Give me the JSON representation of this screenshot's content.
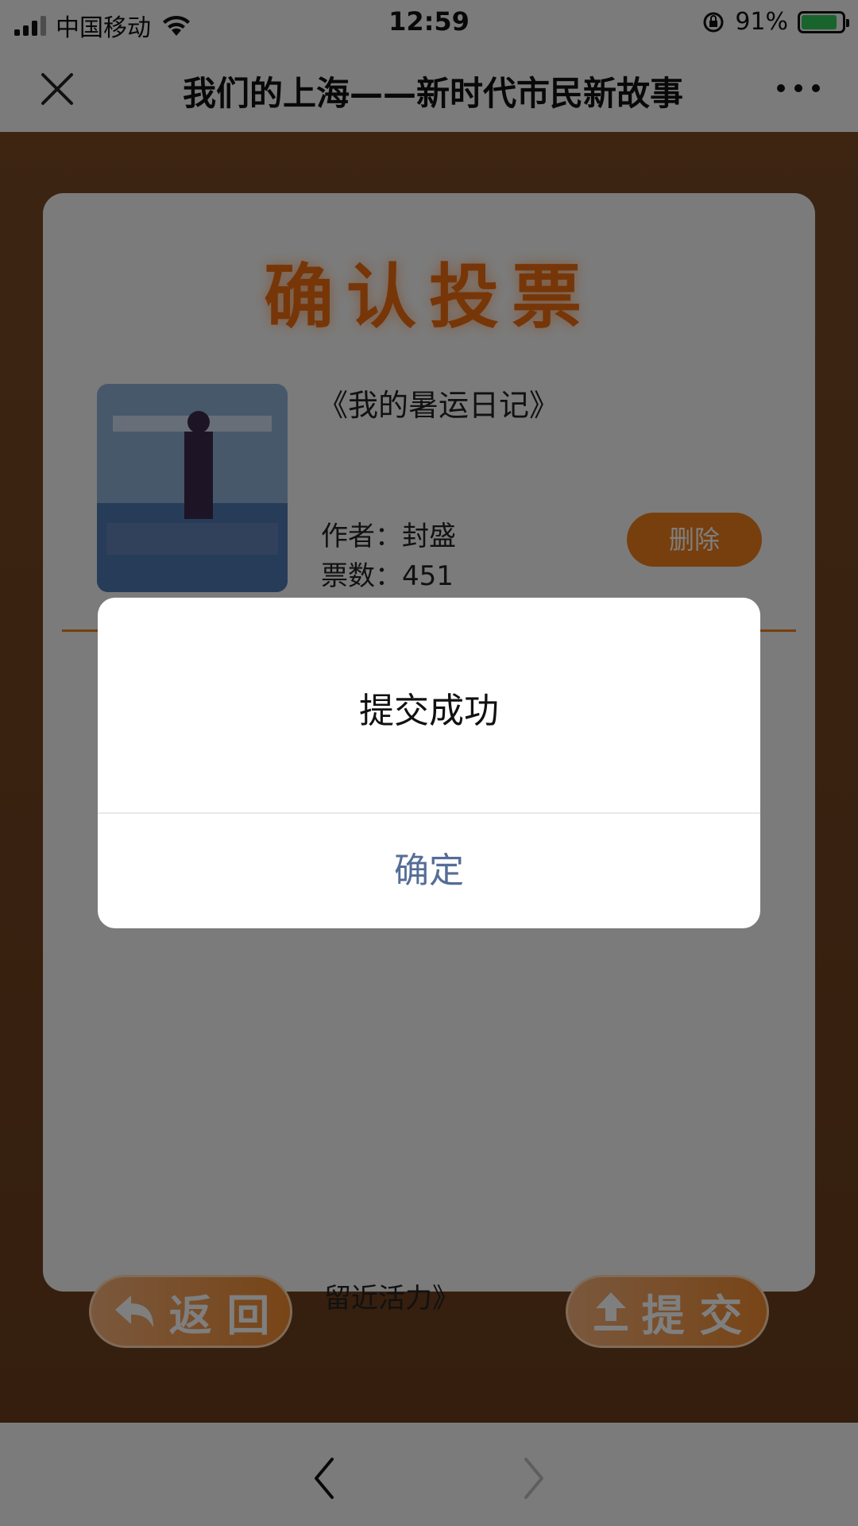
{
  "status_bar": {
    "carrier": "中国移动",
    "time": "12:59",
    "battery_percent": "91%"
  },
  "header": {
    "title": "我们的上海——新时代市民新故事"
  },
  "vote_panel": {
    "title": "确认投票",
    "entry": {
      "title": "《我的暑运日记》",
      "author": "作者：封盛",
      "votes": "票数：451",
      "delete_label": "删除"
    },
    "caption_partial": "留近活力》"
  },
  "bottom_buttons": {
    "back_label": "返 回",
    "submit_label": "提 交"
  },
  "dialog": {
    "message": "提交成功",
    "confirm_label": "确定"
  },
  "colors": {
    "accent_orange": "#ef7f1a",
    "confirm_text": "#556d97"
  }
}
